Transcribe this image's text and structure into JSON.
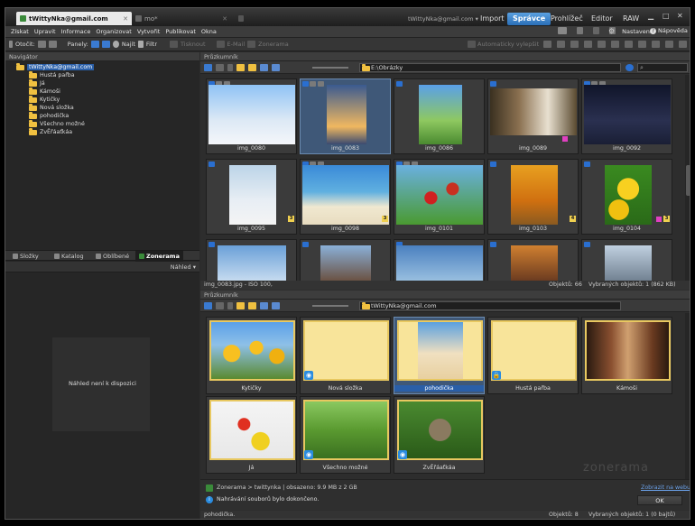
{
  "titlebar": {
    "tabs": [
      {
        "label": "tWittyNka@gmail.com"
      },
      {
        "label": "mo*"
      }
    ],
    "account": "tWittyNka@gmail.com",
    "modes": [
      "Import",
      "Správce",
      "Prohlížeč",
      "Editor",
      "RAW"
    ],
    "active_mode": "Správce"
  },
  "menubar": {
    "items": [
      "Získat",
      "Upravit",
      "Informace",
      "Organizovat",
      "Vytvořit",
      "Publikovat",
      "Okna"
    ],
    "settings": "Nastavení",
    "help": "Nápověda"
  },
  "toolbar": {
    "rotate": "Otočit:",
    "panels": "Panely:",
    "find": "Najít",
    "filter": "Filtr",
    "print": "Tisknout",
    "email": "E-Mail",
    "zonerama": "Zonerama",
    "autofix": "Automaticky vylepšit"
  },
  "navigator": {
    "header": "Navigátor",
    "root": "tWittyNka@gmail.com",
    "folders": [
      "Hustá pařba",
      "Já",
      "Kámoši",
      "Kytičky",
      "Nová složka",
      "pohodička",
      "Všechno možné",
      "ZvĚřáaťkáa"
    ]
  },
  "left_tabs": [
    "Složky",
    "Katalog",
    "Oblíbené",
    "Zonerama"
  ],
  "left_active_tab": "Zonerama",
  "preview": {
    "dropdown": "Náhled",
    "empty_text": "Náhled není k dispozici"
  },
  "explorer_top": {
    "header": "Průzkumník",
    "path": "E:\\Obrázky",
    "images": [
      {
        "name": "img_0080"
      },
      {
        "name": "img_0083"
      },
      {
        "name": "img_0086"
      },
      {
        "name": "img_0089"
      },
      {
        "name": "img_0092"
      },
      {
        "name": "img_0095"
      },
      {
        "name": "img_0098"
      },
      {
        "name": "img_0101"
      },
      {
        "name": "img_0103"
      },
      {
        "name": "img_0104"
      }
    ],
    "status_left": "img_0083.jpg - ISO 100,",
    "status_objects": "Objektů: 66",
    "status_selected": "Vybraných objektů: 1 (862 KB)"
  },
  "explorer_bottom": {
    "header": "Průzkumník",
    "path": "tWittyNka@gmail.com",
    "albums": [
      {
        "name": "Kytičky"
      },
      {
        "name": "Nová složka"
      },
      {
        "name": "pohodička"
      },
      {
        "name": "Hustá pařba"
      },
      {
        "name": "Kámoši"
      },
      {
        "name": "Já"
      },
      {
        "name": "Všechno možné"
      },
      {
        "name": "ZvĚřáaťkáa"
      }
    ],
    "watermark": "zonerama",
    "info_line": "Zonerama > twittynka  | obsazeno: 9.9 MB z 2 GB",
    "show_web": "Zobrazit na webu",
    "upload_done": "Nahrávání souborů bylo dokončeno.",
    "ok": "OK",
    "status_left": "pohodička.",
    "status_objects": "Objektů: 8",
    "status_selected": "Vybraných objektů: 1 (0 bajtů)"
  }
}
